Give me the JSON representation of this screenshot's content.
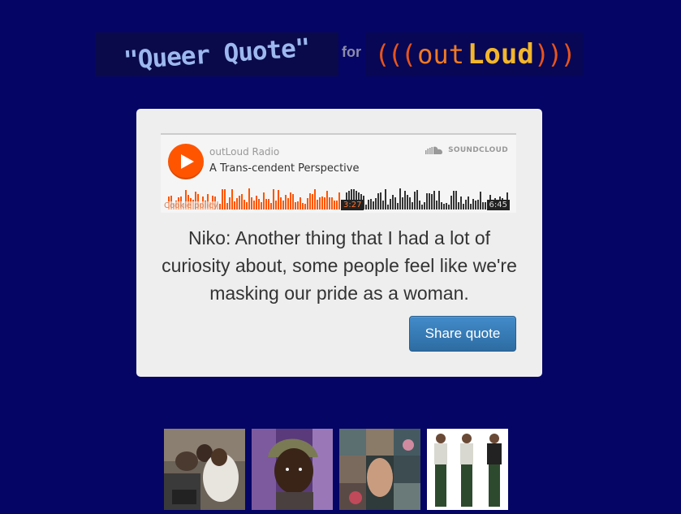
{
  "header": {
    "queer_quote": "\"Queer Quote\"",
    "for_text": "for",
    "outloud_open": "(((",
    "outloud_out": "out",
    "outloud_loud": "Loud",
    "outloud_close": ")))"
  },
  "player": {
    "user": "outLoud Radio",
    "title": "A Trans-cendent Perspective",
    "brand": "SOUNDCLOUD",
    "cookie_policy": "Cookie policy",
    "current_time": "3:27",
    "duration": "6:45",
    "progress_fraction": 0.51,
    "accent_color": "#ff5500"
  },
  "quote": {
    "text": "Niko: Another thing that I had a lot of curiosity about, some people feel like we're masking our pride as a woman."
  },
  "share_button": {
    "label": "Share quote"
  },
  "thumbnails": [
    {
      "name": "thumbnail-radio-studio"
    },
    {
      "name": "thumbnail-portrait-beanie"
    },
    {
      "name": "thumbnail-collage"
    },
    {
      "name": "thumbnail-three-figures"
    }
  ]
}
